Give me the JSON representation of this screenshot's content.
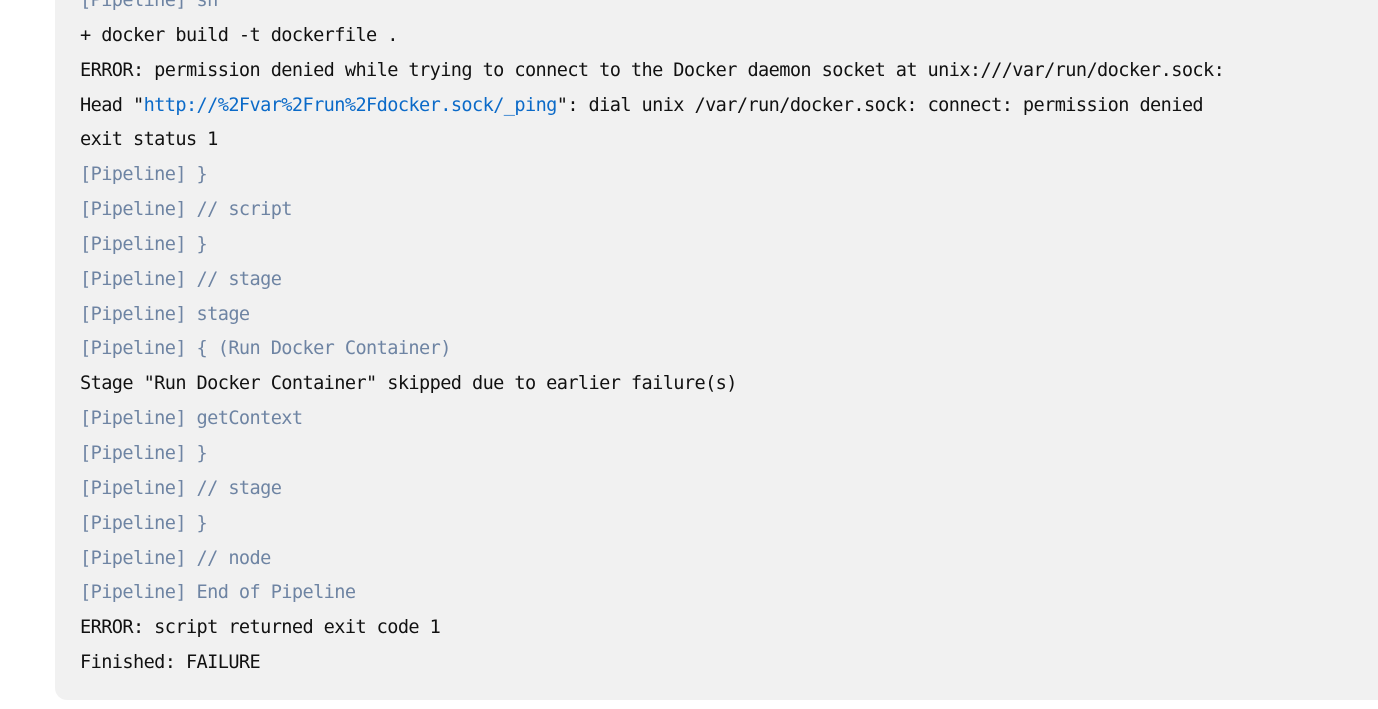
{
  "console": {
    "lines": [
      {
        "type": "pipeline",
        "text": "[Pipeline] sh"
      },
      {
        "type": "plain",
        "text": "+ docker build -t dockerfile ."
      },
      {
        "type": "plain",
        "text": "ERROR: permission denied while trying to connect to the Docker daemon socket at unix:///var/run/docker.sock:"
      },
      {
        "type": "link_line",
        "before": "Head \"",
        "link": "http://%2Fvar%2Frun%2Fdocker.sock/_ping",
        "after": "\": dial unix /var/run/docker.sock: connect: permission denied"
      },
      {
        "type": "plain",
        "text": "exit status 1"
      },
      {
        "type": "pipeline",
        "text": "[Pipeline] }"
      },
      {
        "type": "pipeline",
        "text": "[Pipeline] // script"
      },
      {
        "type": "pipeline",
        "text": "[Pipeline] }"
      },
      {
        "type": "pipeline",
        "text": "[Pipeline] // stage"
      },
      {
        "type": "pipeline",
        "text": "[Pipeline] stage"
      },
      {
        "type": "pipeline",
        "text": "[Pipeline] { (Run Docker Container)"
      },
      {
        "type": "plain",
        "text": "Stage \"Run Docker Container\" skipped due to earlier failure(s)"
      },
      {
        "type": "pipeline",
        "text": "[Pipeline] getContext"
      },
      {
        "type": "pipeline",
        "text": "[Pipeline] }"
      },
      {
        "type": "pipeline",
        "text": "[Pipeline] // stage"
      },
      {
        "type": "pipeline",
        "text": "[Pipeline] }"
      },
      {
        "type": "pipeline",
        "text": "[Pipeline] // node"
      },
      {
        "type": "pipeline",
        "text": "[Pipeline] End of Pipeline"
      },
      {
        "type": "plain",
        "text": "ERROR: script returned exit code 1"
      },
      {
        "type": "plain",
        "text": "Finished: FAILURE"
      }
    ]
  },
  "colors": {
    "panel_background": "#f1f1f1",
    "pipeline_text": "#6e84a3",
    "plain_text": "#111111",
    "link": "#0b6ac8"
  }
}
